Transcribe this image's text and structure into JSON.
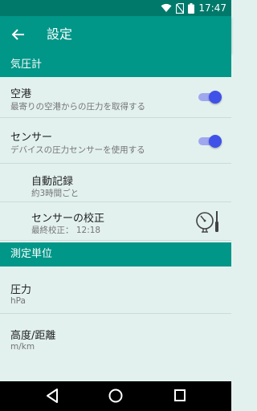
{
  "status_bar": {
    "time": "17:47",
    "icons": [
      "wifi-icon",
      "no-sim-icon",
      "battery-icon"
    ]
  },
  "app_bar": {
    "title": "設定",
    "back_icon": "arrow-back-icon"
  },
  "sections": [
    {
      "header": "気圧計",
      "items": [
        {
          "title": "空港",
          "summary": "最寄りの空港からの圧力を取得する",
          "toggle": true
        },
        {
          "title": "センサー",
          "summary": "デバイスの圧力センサーを使用する",
          "toggle": true
        },
        {
          "title": "自動記録",
          "summary": "約3時間ごと"
        },
        {
          "title": "センサーの校正",
          "summary": "最終校正： 12:18",
          "icon": "gauge-calibration-icon"
        }
      ]
    },
    {
      "header": "測定単位",
      "items": [
        {
          "title": "圧力",
          "summary": "hPa"
        },
        {
          "title": "高度/距離",
          "summary": "m/km"
        }
      ]
    }
  ],
  "nav_bar": {
    "buttons": [
      "back-nav-icon",
      "home-nav-icon",
      "recents-nav-icon"
    ]
  },
  "colors": {
    "primary": "#009688",
    "primary_dark": "#00796b",
    "accent": "#3f51e8",
    "background": "#e2f1ee"
  }
}
